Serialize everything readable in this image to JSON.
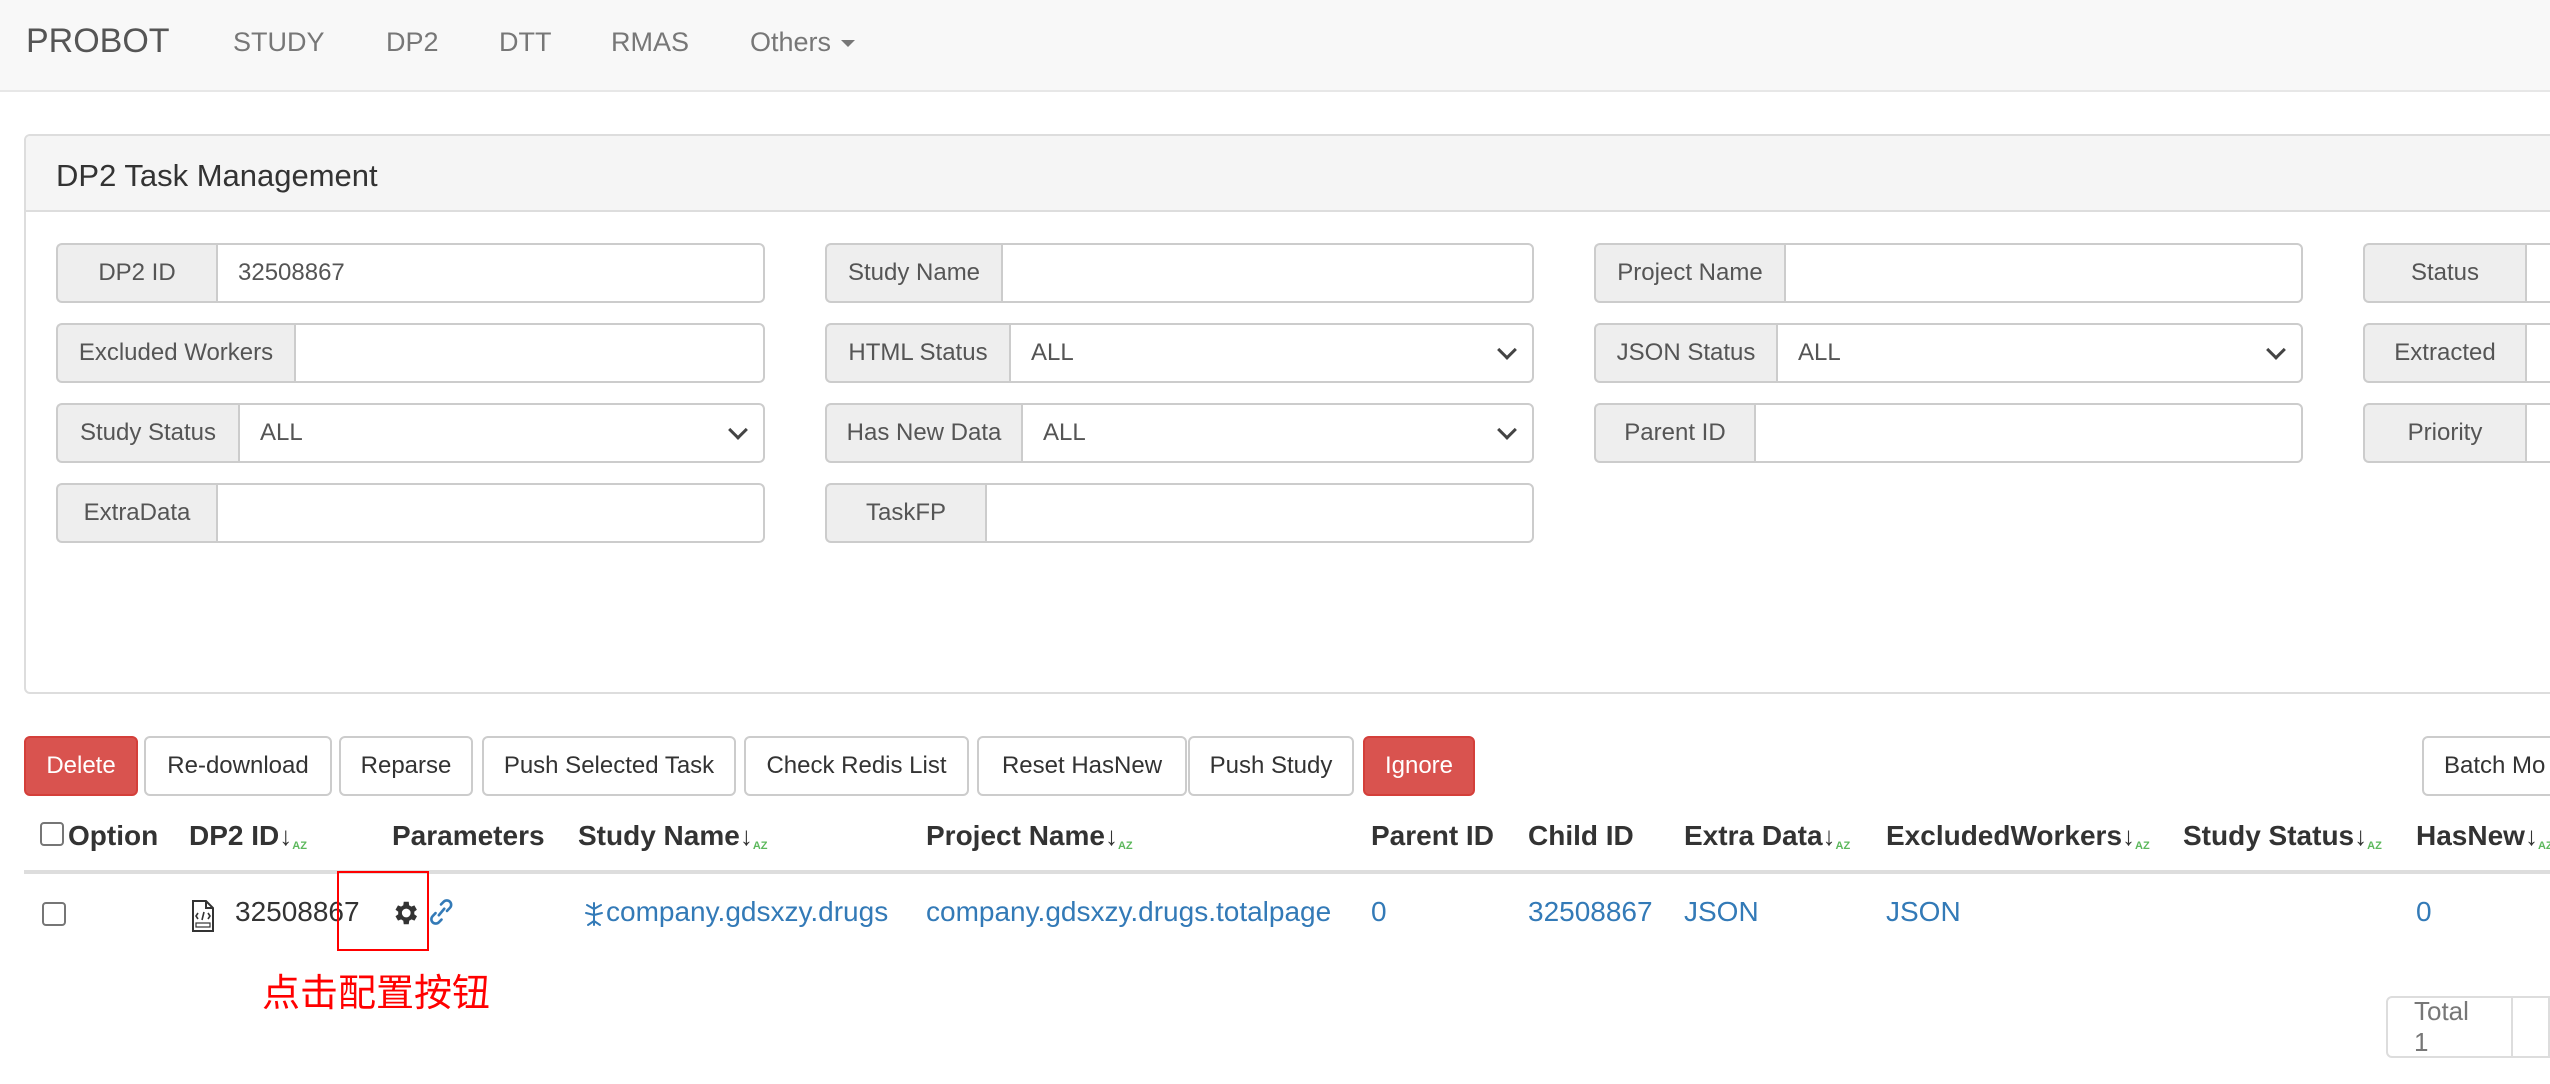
{
  "navbar": {
    "brand": "PROBOT",
    "items": [
      "STUDY",
      "DP2",
      "DTT",
      "RMAS"
    ],
    "others": "Others"
  },
  "panel": {
    "title": "DP2 Task Management",
    "filters": {
      "dp2_id": {
        "label": "DP2 ID",
        "value": "32508867"
      },
      "study_name": {
        "label": "Study Name",
        "value": ""
      },
      "project_name": {
        "label": "Project Name",
        "value": ""
      },
      "status": {
        "label": "Status",
        "value": ""
      },
      "excluded_workers": {
        "label": "Excluded Workers",
        "value": ""
      },
      "html_status": {
        "label": "HTML Status",
        "value": "ALL"
      },
      "json_status": {
        "label": "JSON Status",
        "value": "ALL"
      },
      "extracted": {
        "label": "Extracted",
        "value": ""
      },
      "study_status": {
        "label": "Study Status",
        "value": "ALL"
      },
      "has_new_data": {
        "label": "Has New Data",
        "value": "ALL"
      },
      "parent_id": {
        "label": "Parent ID",
        "value": ""
      },
      "priority": {
        "label": "Priority",
        "value": ""
      },
      "extra_data": {
        "label": "ExtraData",
        "value": ""
      },
      "task_fp": {
        "label": "TaskFP",
        "value": ""
      }
    }
  },
  "actions": {
    "delete": "Delete",
    "redownload": "Re-download",
    "reparse": "Reparse",
    "push_selected": "Push Selected Task",
    "check_redis": "Check Redis List",
    "reset_hasnew": "Reset HasNew",
    "push_study": "Push Study",
    "ignore": "Ignore",
    "batch": "Batch Mo"
  },
  "table": {
    "headers": {
      "option": "Option",
      "dp2_id": "DP2 ID",
      "parameters": "Parameters",
      "study_name": "Study Name",
      "project_name": "Project Name",
      "parent_id": "Parent ID",
      "child_id": "Child ID",
      "extra_data": "Extra Data",
      "excluded_workers": "ExcludedWorkers",
      "study_status": "Study Status",
      "hasnew": "HasNew"
    },
    "rows": [
      {
        "dp2_id": "32508867",
        "study_name": "company.gdsxzy.drugs",
        "project_name": "company.gdsxzy.drugs.totalpage",
        "parent_id": "0",
        "child_id": "32508867",
        "extra_data": "JSON",
        "excluded_workers": "JSON",
        "study_status": "",
        "hasnew": "0"
      }
    ]
  },
  "annotation": "点击配置按钮",
  "pagination": {
    "total": "Total 1"
  },
  "colors": {
    "danger": "#d9534f",
    "link": "#337ab7",
    "annotation": "#ff0000"
  }
}
